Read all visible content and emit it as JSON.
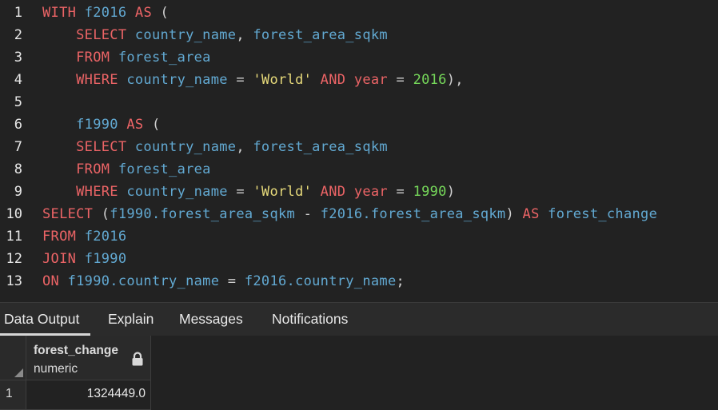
{
  "editor": {
    "line_numbers": [
      "1",
      "2",
      "3",
      "4",
      "5",
      "6",
      "7",
      "8",
      "9",
      "10",
      "11",
      "12",
      "13"
    ],
    "lines": [
      [
        {
          "t": "WITH ",
          "c": "kw"
        },
        {
          "t": "f2016 ",
          "c": "id"
        },
        {
          "t": "AS",
          "c": "kw"
        },
        {
          "t": " (",
          "c": "pu"
        }
      ],
      [
        {
          "t": "    ",
          "c": "id"
        },
        {
          "t": "SELECT ",
          "c": "kw"
        },
        {
          "t": "country_name",
          "c": "id"
        },
        {
          "t": ", ",
          "c": "pu"
        },
        {
          "t": "forest_area_sqkm",
          "c": "id"
        }
      ],
      [
        {
          "t": "    ",
          "c": "id"
        },
        {
          "t": "FROM ",
          "c": "kw"
        },
        {
          "t": "forest_area",
          "c": "id"
        }
      ],
      [
        {
          "t": "    ",
          "c": "id"
        },
        {
          "t": "WHERE ",
          "c": "kw"
        },
        {
          "t": "country_name ",
          "c": "id"
        },
        {
          "t": "= ",
          "c": "pu"
        },
        {
          "t": "'World' ",
          "c": "st"
        },
        {
          "t": "AND ",
          "c": "kw"
        },
        {
          "t": "year ",
          "c": "kw"
        },
        {
          "t": "= ",
          "c": "pu"
        },
        {
          "t": "2016",
          "c": "nm"
        },
        {
          "t": "),",
          "c": "pu"
        }
      ],
      [],
      [
        {
          "t": "    ",
          "c": "id"
        },
        {
          "t": "f1990 ",
          "c": "id"
        },
        {
          "t": "AS",
          "c": "kw"
        },
        {
          "t": " (",
          "c": "pu"
        }
      ],
      [
        {
          "t": "    ",
          "c": "id"
        },
        {
          "t": "SELECT ",
          "c": "kw"
        },
        {
          "t": "country_name",
          "c": "id"
        },
        {
          "t": ", ",
          "c": "pu"
        },
        {
          "t": "forest_area_sqkm",
          "c": "id"
        }
      ],
      [
        {
          "t": "    ",
          "c": "id"
        },
        {
          "t": "FROM ",
          "c": "kw"
        },
        {
          "t": "forest_area",
          "c": "id"
        }
      ],
      [
        {
          "t": "    ",
          "c": "id"
        },
        {
          "t": "WHERE ",
          "c": "kw"
        },
        {
          "t": "country_name ",
          "c": "id"
        },
        {
          "t": "= ",
          "c": "pu"
        },
        {
          "t": "'World' ",
          "c": "st"
        },
        {
          "t": "AND ",
          "c": "kw"
        },
        {
          "t": "year ",
          "c": "kw"
        },
        {
          "t": "= ",
          "c": "pu"
        },
        {
          "t": "1990",
          "c": "nm"
        },
        {
          "t": ")",
          "c": "pu"
        }
      ],
      [
        {
          "t": "SELECT ",
          "c": "kw"
        },
        {
          "t": "(",
          "c": "pu"
        },
        {
          "t": "f1990.forest_area_sqkm ",
          "c": "id"
        },
        {
          "t": "- ",
          "c": "pu"
        },
        {
          "t": "f2016.forest_area_sqkm",
          "c": "id"
        },
        {
          "t": ") ",
          "c": "pu"
        },
        {
          "t": "AS ",
          "c": "kw"
        },
        {
          "t": "forest_change",
          "c": "id"
        }
      ],
      [
        {
          "t": "FROM ",
          "c": "kw"
        },
        {
          "t": "f2016",
          "c": "id"
        }
      ],
      [
        {
          "t": "JOIN ",
          "c": "kw"
        },
        {
          "t": "f1990",
          "c": "id"
        }
      ],
      [
        {
          "t": "ON ",
          "c": "kw"
        },
        {
          "t": "f1990.country_name ",
          "c": "id"
        },
        {
          "t": "= ",
          "c": "pu"
        },
        {
          "t": "f2016.country_name",
          "c": "id"
        },
        {
          "t": ";",
          "c": "pu"
        }
      ]
    ]
  },
  "tabs": [
    {
      "label": "Data Output",
      "active": true
    },
    {
      "label": "Explain",
      "active": false
    },
    {
      "label": "Messages",
      "active": false
    },
    {
      "label": "Notifications",
      "active": false
    }
  ],
  "grid": {
    "column": {
      "name": "forest_change",
      "type": "numeric",
      "icon": "lock-icon"
    },
    "rows": [
      {
        "num": "1",
        "value": "1324449.0"
      }
    ]
  }
}
